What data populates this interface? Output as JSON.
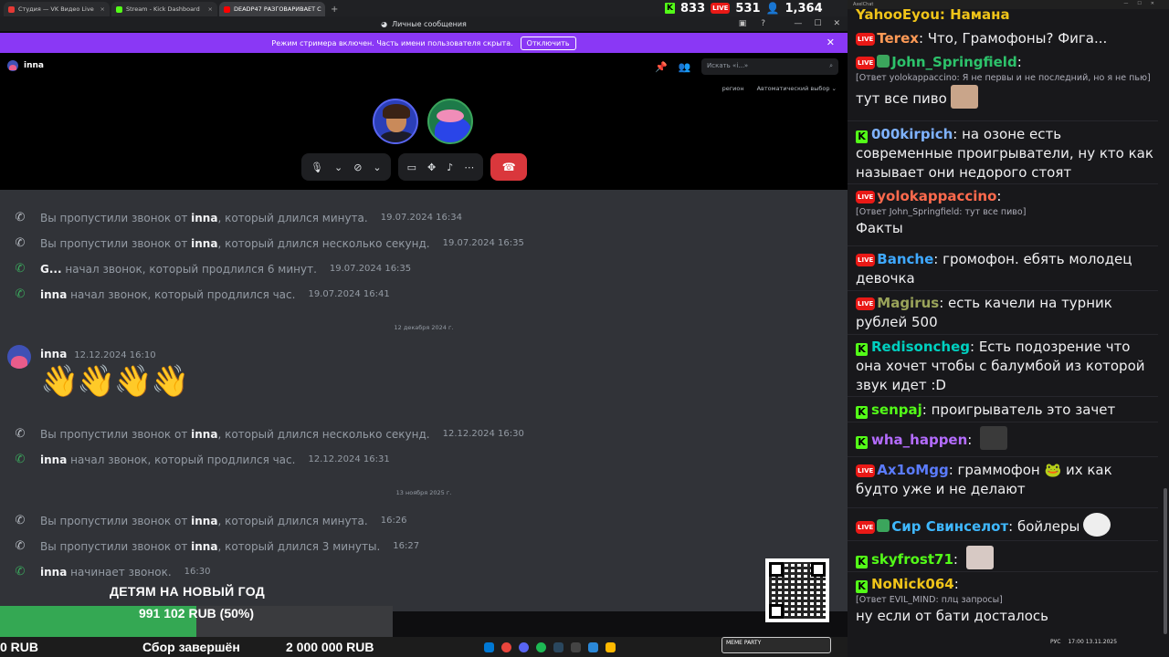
{
  "browser": {
    "tabs": [
      {
        "label": "Студия — VK Видео Live",
        "color": "#e53935"
      },
      {
        "label": "Stream - Kick Dashboard",
        "color": "#53fc18"
      },
      {
        "label": "DEADP47 РАЗГОВАРИВАЕТ С",
        "color": "#ff0000"
      }
    ],
    "new_tab": "+"
  },
  "stats": {
    "kick": "833",
    "live": "531",
    "viewers": "1,364",
    "kick_badge": "K",
    "live_badge": "LIVE"
  },
  "discord": {
    "window_title": "Личные сообщения",
    "banner_text": "Режим стримера включен. Часть имени пользователя скрыта.",
    "banner_button": "Отключить",
    "call_user": "inna",
    "search_placeholder": "Искать «i...»",
    "region_label": "регион",
    "region_value": "Автоматический выбор",
    "messages": [
      {
        "type": "missed",
        "pre": "Вы пропустили звонок от ",
        "user": "inna",
        "post": ", который длился минута.",
        "ts": "19.07.2024 16:34"
      },
      {
        "type": "missed",
        "pre": "Вы пропустили звонок от ",
        "user": "inna",
        "post": ", который длился несколько секунд.",
        "ts": "19.07.2024 16:35"
      },
      {
        "type": "call",
        "pre": "",
        "user": "G...",
        "post": " начал звонок, который продлился 6 минут.",
        "ts": "19.07.2024 16:35"
      },
      {
        "type": "call",
        "pre": "",
        "user": "inna",
        "post": " начал звонок, который продлился час.",
        "ts": "19.07.2024 16:41"
      },
      {
        "type": "missed",
        "pre": "Вы пропустили звонок от ",
        "user": "inna",
        "post": ", который длился несколько секунд.",
        "ts": "12.12.2024 16:30"
      },
      {
        "type": "call",
        "pre": "",
        "user": "inna",
        "post": " начал звонок, который продлился час.",
        "ts": "12.12.2024 16:31"
      },
      {
        "type": "missed",
        "pre": "Вы пропустили звонок от ",
        "user": "inna",
        "post": ", который длился минута.",
        "ts": "16:26"
      },
      {
        "type": "missed",
        "pre": "Вы пропустили звонок от ",
        "user": "inna",
        "post": ", который длился 3 минуты.",
        "ts": "16:27"
      },
      {
        "type": "call",
        "pre": "",
        "user": "inna",
        "post": " начинает звонок.",
        "ts": "16:30"
      }
    ],
    "date_dividers": [
      "12 декабря 2024 г.",
      "13 ноября 2025 г."
    ],
    "post": {
      "user": "inna",
      "ts": "12.12.2024 16:10",
      "content": "👋👋👋👋"
    }
  },
  "donation": {
    "title": "ДЕТЯМ НА НОВЫЙ ГОД",
    "progress_text": "991 102 RUB (50%)",
    "progress_fraction": 0.5,
    "left_amount": "0 RUB",
    "status": "Сбор завершён",
    "goal": "2 000 000 RUB"
  },
  "taskbar": {
    "meme_label": "MEME PARTY",
    "lang": "РУС",
    "time": "17:00",
    "date": "13.11.2025"
  },
  "chat": {
    "window_title": "AxelChat",
    "messages": [
      {
        "badges": [
          "live"
        ],
        "name": "Terex",
        "color": "#ff9a56",
        "text": "Что, Грамофоны? Фига..."
      },
      {
        "badges": [
          "live",
          "green"
        ],
        "name": "John_Springfield",
        "color": "#2dc26b",
        "reply": "[Ответ yolokappaccino: Я не первы и не последний, но я не пью]",
        "text": "тут все пиво"
      },
      {
        "badges": [
          "kick"
        ],
        "name": "000kirpich",
        "color": "#7fb2ff",
        "text": "на озоне есть современные проигрыватели, ну кто как называет они недорого стоят"
      },
      {
        "badges": [
          "live"
        ],
        "name": "yolokappaccino",
        "color": "#ff6a4d",
        "reply": "[Ответ John_Springfield: тут все пиво]",
        "text": "Факты"
      },
      {
        "badges": [
          "live"
        ],
        "name": "Banche",
        "color": "#3fa9ff",
        "text": "громофон. ебять молодец девочка"
      },
      {
        "badges": [
          "live"
        ],
        "name": "Magirus",
        "color": "#9aa45a",
        "text": "есть качели на турник рублей 500"
      },
      {
        "badges": [
          "kick"
        ],
        "name": "Redisoncheg",
        "color": "#00d0c0",
        "text": "Есть подозрение что она хочет чтобы с балумбой из которой звук идет :D"
      },
      {
        "badges": [
          "kick"
        ],
        "name": "senpaj",
        "color": "#53fc18",
        "text": "проигрыватель это зачет"
      },
      {
        "badges": [
          "kick"
        ],
        "name": "wha_happen",
        "color": "#b46cff",
        "text": ""
      },
      {
        "badges": [
          "live"
        ],
        "name": "Ax1oMgg",
        "color": "#5b7cff",
        "text": "граммофон 🐸 их как будто уже и не делают"
      },
      {
        "badges": [
          "live",
          "green"
        ],
        "name": "Сир Свинселот",
        "color": "#3fb8ff",
        "text": "бойлеры"
      },
      {
        "badges": [
          "kick"
        ],
        "name": "skyfrost71",
        "color": "#53fc18",
        "text": ""
      },
      {
        "badges": [
          "kick"
        ],
        "name": "NoNick064",
        "color": "#f0c419",
        "reply": "[Ответ EVIL_MIND: плц запросы]",
        "text": "ну если от бати досталось"
      }
    ],
    "top_partial": "YahooEyou: Намана"
  }
}
